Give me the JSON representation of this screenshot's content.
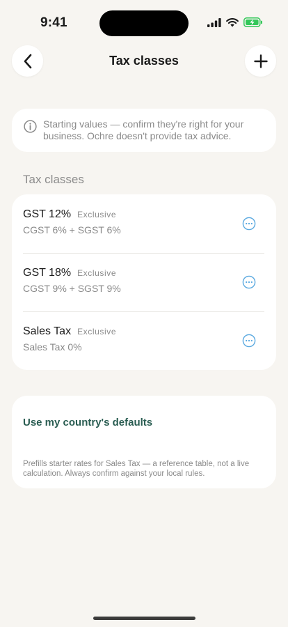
{
  "status_bar": {
    "time": "9:41",
    "icons": [
      "cellular-signal-icon",
      "wifi-icon",
      "battery-charging-icon"
    ],
    "battery_color": "#33c759"
  },
  "nav": {
    "title": "Tax classes",
    "back_icon": "chevron-left-icon",
    "add_icon": "plus-icon"
  },
  "info_banner": {
    "icon": "info-icon",
    "text": "Starting values — confirm they're right for your business. Ochre doesn't provide tax advice."
  },
  "section": {
    "title": "Tax classes"
  },
  "tax_classes": [
    {
      "name": "GST 12%",
      "mode": "Exclusive",
      "breakdown": "CGST 6% + SGST 6%",
      "menu_icon": "more-options-icon"
    },
    {
      "name": "GST 18%",
      "mode": "Exclusive",
      "breakdown": "CGST 9% + SGST 9%",
      "menu_icon": "more-options-icon"
    },
    {
      "name": "Sales Tax",
      "mode": "Exclusive",
      "breakdown": "Sales Tax 0%",
      "menu_icon": "more-options-icon"
    }
  ],
  "defaults": {
    "link_label": "Use my country's defaults",
    "note": "Prefills starter rates for Sales Tax — a reference table, not a live calculation. Always confirm against your local rules."
  },
  "colors": {
    "background": "#f7f5f1",
    "card": "#ffffff",
    "accent_green": "#2a5d52",
    "menu_icon_blue": "#5aa9e0",
    "secondary_text": "#8a8a8a"
  }
}
